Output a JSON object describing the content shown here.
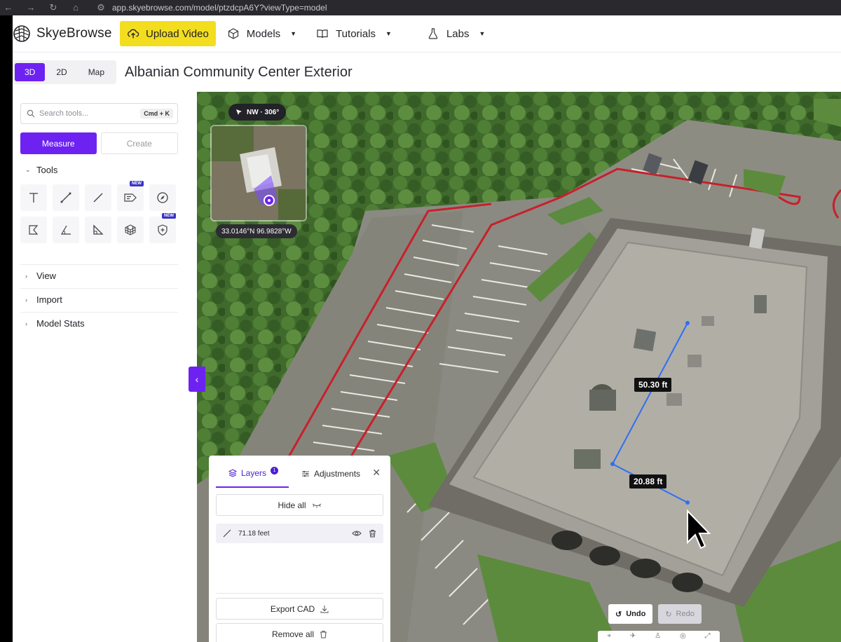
{
  "browser": {
    "url": "app.skyebrowse.com/model/ptzdcpA6Y?viewType=model",
    "icons": [
      "back-arrow-icon",
      "forward-arrow-icon",
      "reload-icon",
      "home-icon",
      "site-settings-icon"
    ]
  },
  "nav": {
    "brand": "SkyeBrowse",
    "upload_label": "Upload Video",
    "items": [
      {
        "label": "Models",
        "icon": "cube-icon"
      },
      {
        "label": "Tutorials",
        "icon": "book-icon"
      },
      {
        "label": "Labs",
        "icon": "flask-icon"
      }
    ]
  },
  "subheader": {
    "view_modes": [
      "3D",
      "2D",
      "Map"
    ],
    "active_view": "3D",
    "title": "Albanian Community Center Exterior"
  },
  "sidebar": {
    "search_placeholder": "Search tools...",
    "search_shortcut": "Cmd + K",
    "mode_tabs": [
      "Measure",
      "Create"
    ],
    "active_mode": "Measure",
    "sections": {
      "tools": "Tools",
      "view": "View",
      "import": "Import",
      "model_stats": "Model Stats"
    },
    "tools": [
      {
        "name": "text-tool-icon",
        "new": false
      },
      {
        "name": "measure-line-icon",
        "new": false
      },
      {
        "name": "line-tool-icon",
        "new": false
      },
      {
        "name": "annotation-tool-icon",
        "new": true
      },
      {
        "name": "compass-tool-icon",
        "new": false
      },
      {
        "name": "area-tool-icon",
        "new": false
      },
      {
        "name": "angle-tool-icon",
        "new": false
      },
      {
        "name": "height-tool-icon",
        "new": false
      },
      {
        "name": "volume-tool-icon",
        "new": false
      },
      {
        "name": "shield-plus-icon",
        "new": true
      }
    ],
    "new_badge": "NEW"
  },
  "viewport": {
    "compass": "NW · 306°",
    "coordinates": "33.0146°N 96.9828°W",
    "measurements": [
      "50.30 ft",
      "20.88 ft"
    ]
  },
  "layers_panel": {
    "tabs": [
      "Layers",
      "Adjustments"
    ],
    "layer_count": "1",
    "hide_all": "Hide all",
    "layer_items": [
      {
        "label": "71.18 feet"
      }
    ],
    "export_cad": "Export CAD",
    "remove_all": "Remove all"
  },
  "controls": {
    "undo": "Undo",
    "redo": "Redo"
  },
  "colors": {
    "accent": "#6d22f2",
    "upload": "#f3dd1f",
    "measure_line": "#2f6ff5",
    "curb_red": "#c8202b"
  }
}
